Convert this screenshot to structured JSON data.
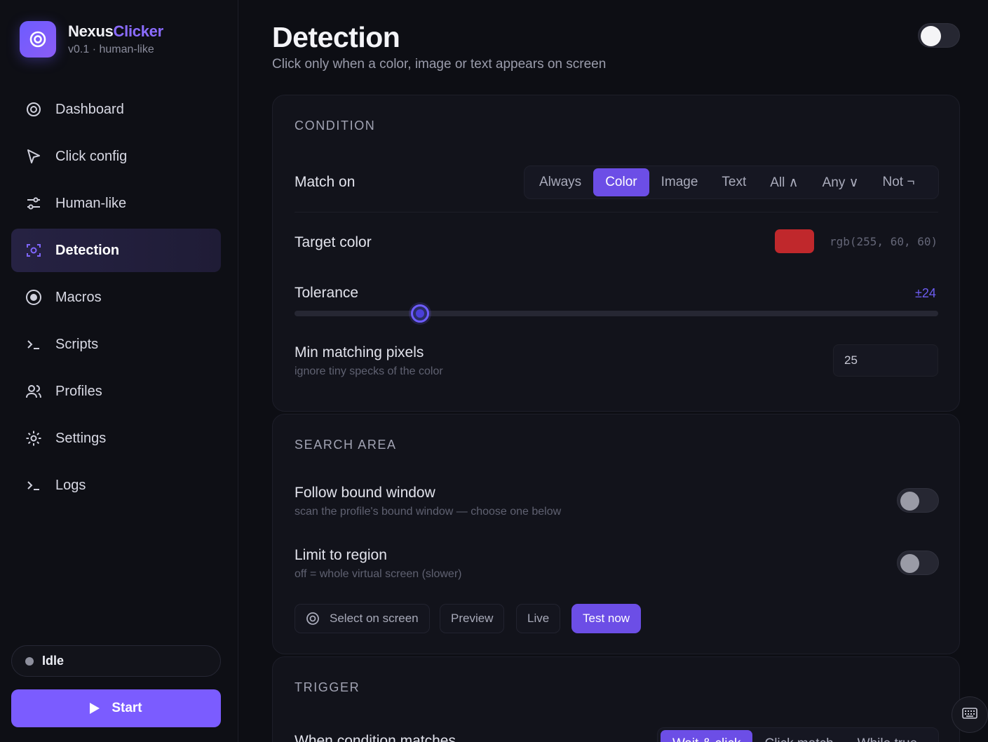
{
  "brand": {
    "name_part1": "Nexus",
    "name_part2": "Clicker",
    "subtitle": "v0.1 · human-like"
  },
  "nav": [
    {
      "label": "Dashboard",
      "icon": "dashboard-icon"
    },
    {
      "label": "Click config",
      "icon": "cursor-icon"
    },
    {
      "label": "Human-like",
      "icon": "sliders-icon"
    },
    {
      "label": "Detection",
      "icon": "scan-icon",
      "active": true
    },
    {
      "label": "Macros",
      "icon": "record-icon"
    },
    {
      "label": "Scripts",
      "icon": "terminal-icon"
    },
    {
      "label": "Profiles",
      "icon": "users-icon"
    },
    {
      "label": "Settings",
      "icon": "gear-icon"
    },
    {
      "label": "Logs",
      "icon": "terminal-icon"
    }
  ],
  "status": {
    "label": "Idle"
  },
  "start_button": {
    "label": "Start"
  },
  "page": {
    "title": "Detection",
    "subtitle": "Click only when a color, image or text appears on screen",
    "enabled": false
  },
  "condition": {
    "title": "CONDITION",
    "match_on": {
      "label": "Match on",
      "options": [
        "Always",
        "Color",
        "Image",
        "Text",
        "All ∧",
        "Any ∨",
        "Not ¬"
      ],
      "selected": "Color"
    },
    "target_color": {
      "label": "Target color",
      "value": "rgb(255, 60, 60)",
      "swatch": "#c0282c"
    },
    "tolerance": {
      "label": "Tolerance",
      "value_text": "±24",
      "fraction": 0.195
    },
    "min_pixels": {
      "label": "Min matching pixels",
      "hint": "ignore tiny specks of the color",
      "value": "25"
    }
  },
  "search_area": {
    "title": "SEARCH AREA",
    "follow_window": {
      "label": "Follow bound window",
      "hint": "scan the profile's bound window — choose one below",
      "on": false
    },
    "limit_region": {
      "label": "Limit to region",
      "hint": "off = whole virtual screen (slower)",
      "on": false
    },
    "buttons": {
      "select": "Select on screen",
      "preview": "Preview",
      "live": "Live",
      "test": "Test now"
    }
  },
  "trigger": {
    "title": "TRIGGER",
    "label": "When condition matches",
    "options": [
      "Wait & click",
      "Click match",
      "While true"
    ],
    "selected": "Wait & click"
  },
  "colors": {
    "accent": "#6c4ee6",
    "brand_accent": "#8b6cff"
  }
}
